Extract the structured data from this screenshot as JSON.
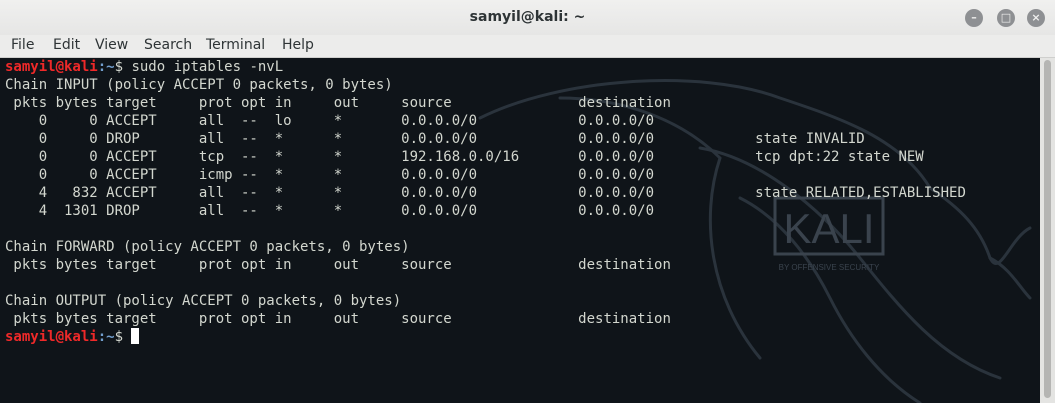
{
  "window": {
    "title": "samyil@kali: ~",
    "min_icon": "minimize-icon",
    "max_icon": "maximize-icon",
    "close_icon": "close-icon",
    "min_glyph": "–",
    "max_glyph": "□",
    "close_glyph": "×"
  },
  "menu": [
    "File",
    "Edit",
    "View",
    "Search",
    "Terminal",
    "Help"
  ],
  "terminal": {
    "background": "#0f1419",
    "prompt_user": "samyil@kali",
    "prompt_path": ":~",
    "prompt_symbol": "$",
    "command": " sudo iptables -nvL",
    "output_lines": [
      "Chain INPUT (policy ACCEPT 0 packets, 0 bytes)",
      " pkts bytes target     prot opt in     out     source               destination",
      "    0     0 ACCEPT     all  --  lo     *       0.0.0.0/0            0.0.0.0/0",
      "    0     0 DROP       all  --  *      *       0.0.0.0/0            0.0.0.0/0            state INVALID",
      "    0     0 ACCEPT     tcp  --  *      *       192.168.0.0/16       0.0.0.0/0            tcp dpt:22 state NEW",
      "    0     0 ACCEPT     icmp --  *      *       0.0.0.0/0            0.0.0.0/0",
      "    4   832 ACCEPT     all  --  *      *       0.0.0.0/0            0.0.0.0/0            state RELATED,ESTABLISHED",
      "    4  1301 DROP       all  --  *      *       0.0.0.0/0            0.0.0.0/0",
      "",
      "Chain FORWARD (policy ACCEPT 0 packets, 0 bytes)",
      " pkts bytes target     prot opt in     out     source               destination",
      "",
      "Chain OUTPUT (policy ACCEPT 0 packets, 0 bytes)",
      " pkts bytes target     prot opt in     out     source               destination"
    ]
  },
  "watermark": {
    "logo_text": "KALI",
    "tagline": "BY OFFENSIVE SECURITY"
  }
}
